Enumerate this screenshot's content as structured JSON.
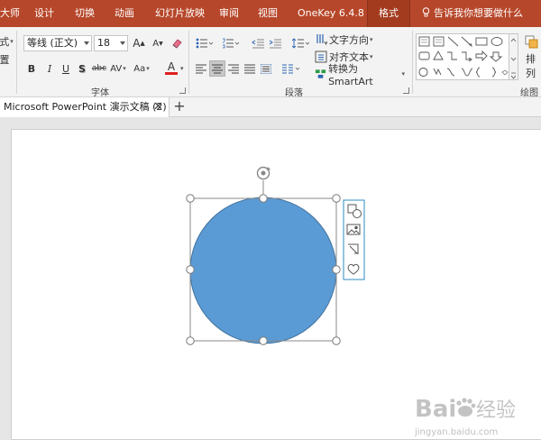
{
  "ribbon_tabs": [
    {
      "label": "大师",
      "active": false
    },
    {
      "label": "设计",
      "active": false
    },
    {
      "label": "切换",
      "active": false
    },
    {
      "label": "动画",
      "active": false
    },
    {
      "label": "幻灯片放映",
      "active": false
    },
    {
      "label": "审阅",
      "active": false
    },
    {
      "label": "视图",
      "active": false
    },
    {
      "label": "OneKey 6.4.8",
      "active": false
    },
    {
      "label": "格式",
      "active": true
    }
  ],
  "tell_me": {
    "label": "告诉我你想要做什么",
    "icon": "lightbulb-icon"
  },
  "font_group": {
    "label": "字体",
    "font_name": "等线 (正文)",
    "font_size": "18",
    "left_cut_top": "式",
    "left_cut_bottom": "置",
    "grow_font": "A",
    "shrink_font": "A",
    "clear_format_icon": "eraser-icon",
    "bold": "B",
    "italic": "I",
    "underline": "U",
    "shadow": "S",
    "strikethrough": "abc",
    "spacing": "AV",
    "change_case": "Aa",
    "font_color": "A",
    "font_color_value": "#e02020"
  },
  "paragraph_group": {
    "label": "段落",
    "text_direction": "文字方向",
    "align_text": "对齐文本",
    "convert_smartart": "转换为 SmartArt"
  },
  "drawing_group": {
    "label": "绘图",
    "arrange_label": "排列"
  },
  "document_tab": {
    "title": "Microsoft PowerPoint 演示文稿 (2)",
    "close": "✕",
    "new_tab": "+"
  },
  "slide": {
    "shape": "circle",
    "fill_color": "#5b9bd5",
    "outline_color": "#41719c"
  },
  "side_tools": [
    "layout-options-icon",
    "image-icon",
    "crop-icon",
    "heart-icon"
  ],
  "watermark": {
    "brand": "Bai",
    "brand_cn": "经验",
    "url": "jingyan.baidu.com"
  }
}
